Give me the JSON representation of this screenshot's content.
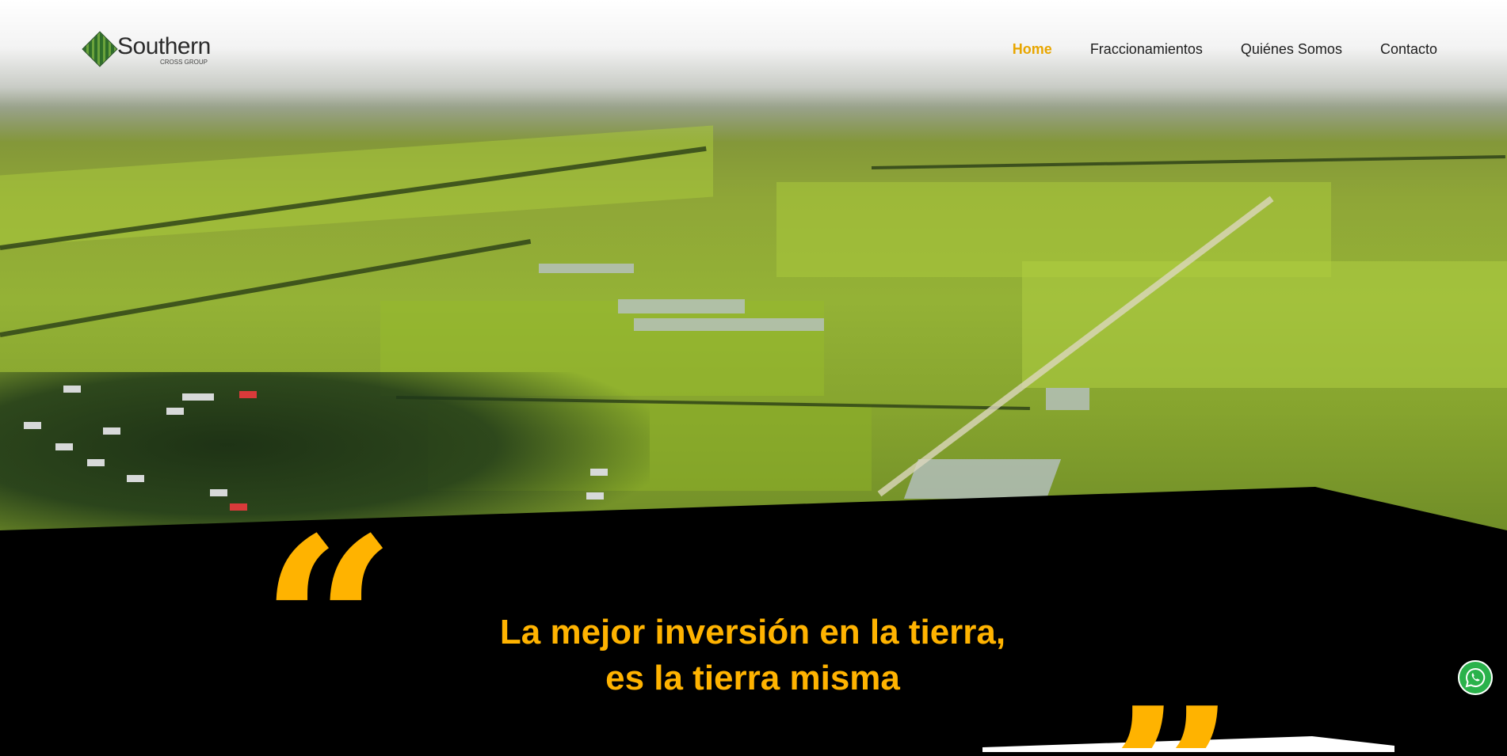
{
  "brand": {
    "name": "Southern",
    "subtitle": "CROSS GROUP"
  },
  "nav": {
    "items": [
      {
        "label": "Home",
        "active": true
      },
      {
        "label": "Fraccionamientos",
        "active": false
      },
      {
        "label": "Quiénes Somos",
        "active": false
      },
      {
        "label": "Contacto",
        "active": false
      }
    ]
  },
  "hero": {
    "image": "aerial-farmland-photo"
  },
  "quote": {
    "line1": "La mejor inversión en la tierra,",
    "line2": "es la tierra misma"
  },
  "colors": {
    "accent": "#ffb300",
    "band": "#000000",
    "whatsapp": "#2ab24b"
  },
  "icons": {
    "whatsapp": "whatsapp-icon",
    "quote_open": "open-quote-icon",
    "quote_close": "close-quote-icon"
  }
}
